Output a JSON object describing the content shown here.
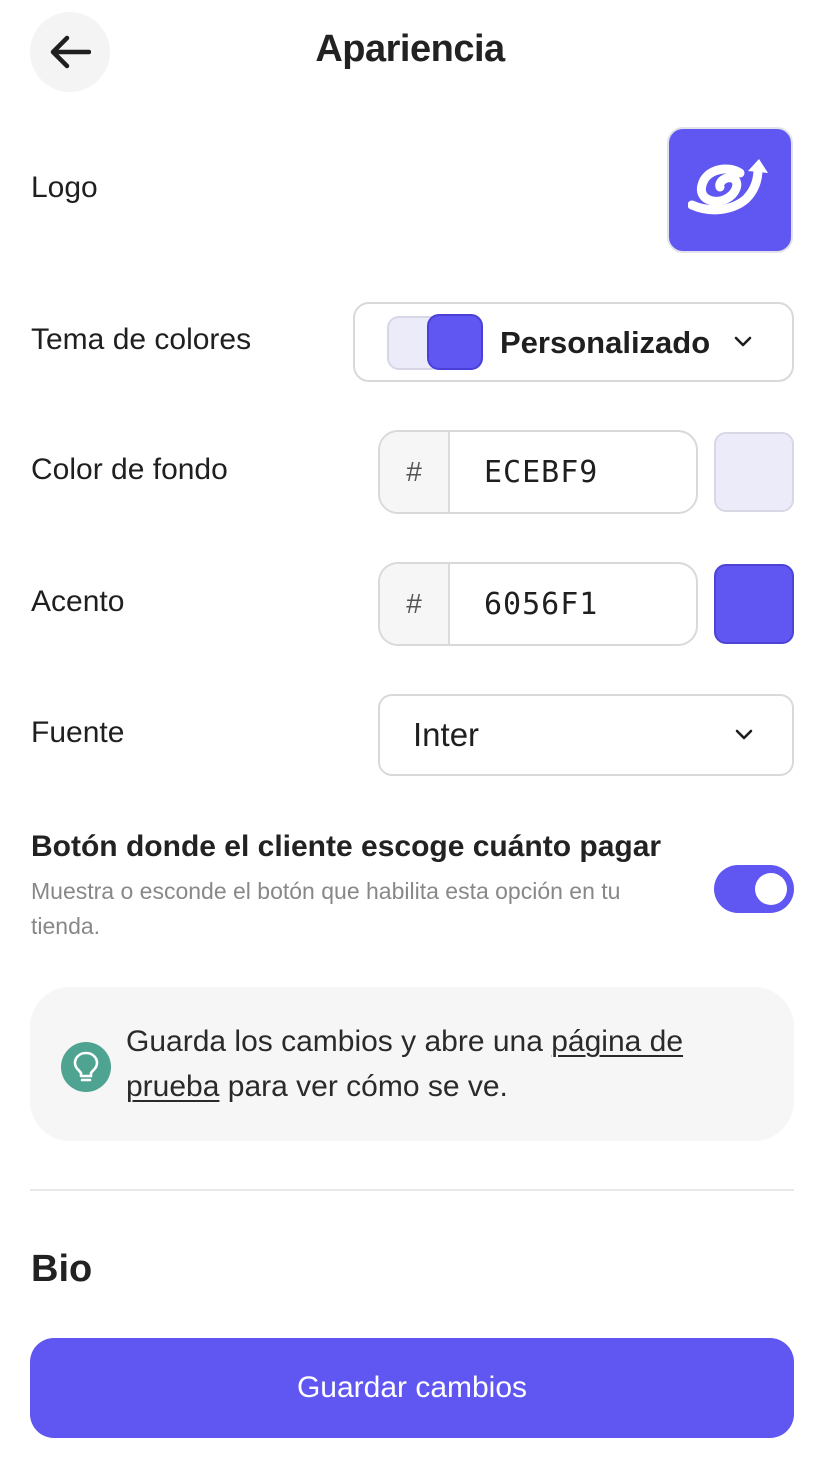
{
  "header": {
    "title": "Apariencia"
  },
  "logo": {
    "label": "Logo"
  },
  "theme": {
    "label": "Tema de colores",
    "selected": "Personalizado"
  },
  "background_color": {
    "label": "Color de fondo",
    "prefix": "#",
    "value": "ECEBF9",
    "swatch": "#ECEBF9"
  },
  "accent_color": {
    "label": "Acento",
    "prefix": "#",
    "value": "6056F1",
    "swatch": "#6056F1"
  },
  "font": {
    "label": "Fuente",
    "selected": "Inter"
  },
  "pay_what_you_want": {
    "title": "Botón donde el cliente escoge cuánto pagar",
    "description": "Muestra o esconde el botón que habilita esta opción en tu tienda.",
    "enabled": true
  },
  "tip": {
    "text_before": "Guarda los cambios y abre una ",
    "link": "página de prueba",
    "text_after": " para ver cómo se ve."
  },
  "bio": {
    "title": "Bio"
  },
  "actions": {
    "save_label": "Guardar cambios"
  },
  "icons": {
    "back": "arrow-left-icon",
    "logo": "horn-logo-icon",
    "dropdown": "chevron-down-icon",
    "tip": "lightbulb-icon"
  },
  "colors": {
    "accent": "#6056F1",
    "tip_icon": "#4fa391"
  }
}
